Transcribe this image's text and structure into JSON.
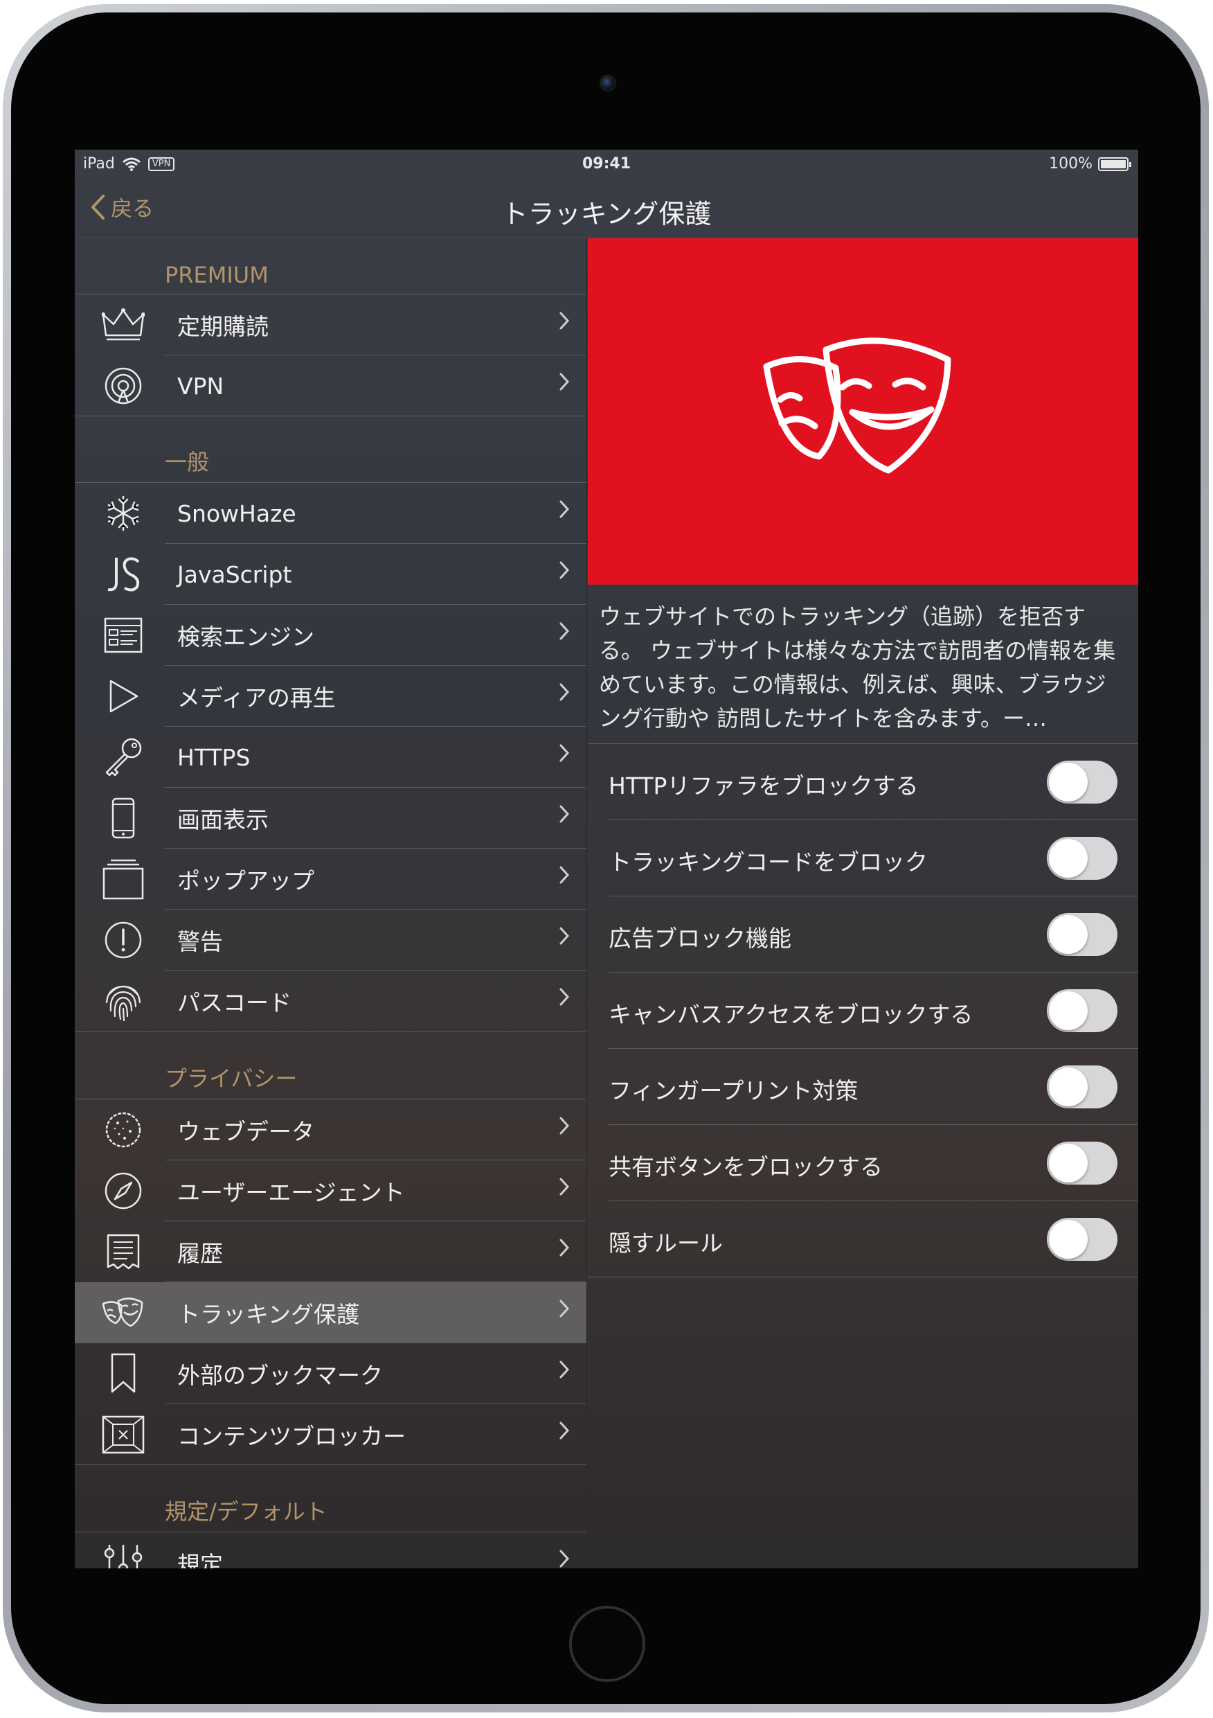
{
  "status_bar": {
    "device": "iPad",
    "vpn": "VPN",
    "time": "09:41",
    "battery": "100%"
  },
  "nav": {
    "back_label": "戻る",
    "title": "トラッキング保護"
  },
  "accent_color": "#b0946a",
  "hero_color": "#e2111f",
  "sidebar": {
    "sections": [
      {
        "header": "PREMIUM",
        "items": [
          {
            "label": "定期購読",
            "icon": "crown-icon"
          },
          {
            "label": "VPN",
            "icon": "vpn-signal-icon"
          }
        ]
      },
      {
        "header": "一般",
        "items": [
          {
            "label": "SnowHaze",
            "icon": "snowflake-icon"
          },
          {
            "label": "JavaScript",
            "icon": "js-icon"
          },
          {
            "label": "検索エンジン",
            "icon": "search-engine-icon"
          },
          {
            "label": "メディアの再生",
            "icon": "play-icon"
          },
          {
            "label": "HTTPS",
            "icon": "key-icon"
          },
          {
            "label": "画面表示",
            "icon": "phone-icon"
          },
          {
            "label": "ポップアップ",
            "icon": "popup-icon"
          },
          {
            "label": "警告",
            "icon": "warning-icon"
          },
          {
            "label": "パスコード",
            "icon": "fingerprint-icon"
          }
        ]
      },
      {
        "header": "プライバシー",
        "items": [
          {
            "label": "ウェブデータ",
            "icon": "cookie-icon"
          },
          {
            "label": "ユーザーエージェント",
            "icon": "compass-icon"
          },
          {
            "label": "履歴",
            "icon": "history-icon"
          },
          {
            "label": "トラッキング保護",
            "icon": "masks-icon",
            "selected": true
          },
          {
            "label": "外部のブックマーク",
            "icon": "bookmark-icon"
          },
          {
            "label": "コンテンツブロッカー",
            "icon": "content-blocker-icon"
          }
        ]
      },
      {
        "header": "規定/デフォルト",
        "items": [
          {
            "label": "規定",
            "icon": "sliders-icon"
          }
        ]
      }
    ]
  },
  "detail": {
    "description": "ウェブサイトでのトラッキング（追跡）を拒否する。 ウェブサイトは様々な方法で訪問者の情報を集めています。この情報は、例えば、興味、ブラウジング行動や 訪問したサイトを含みます。ー…",
    "toggles": [
      {
        "label": "HTTPリファラをブロックする",
        "on": false
      },
      {
        "label": "トラッキングコードをブロック",
        "on": false
      },
      {
        "label": "広告ブロック機能",
        "on": false
      },
      {
        "label": "キャンバスアクセスをブロックする",
        "on": false
      },
      {
        "label": "フィンガープリント対策",
        "on": false
      },
      {
        "label": "共有ボタンをブロックする",
        "on": false
      },
      {
        "label": "隠すルール",
        "on": false
      }
    ]
  }
}
